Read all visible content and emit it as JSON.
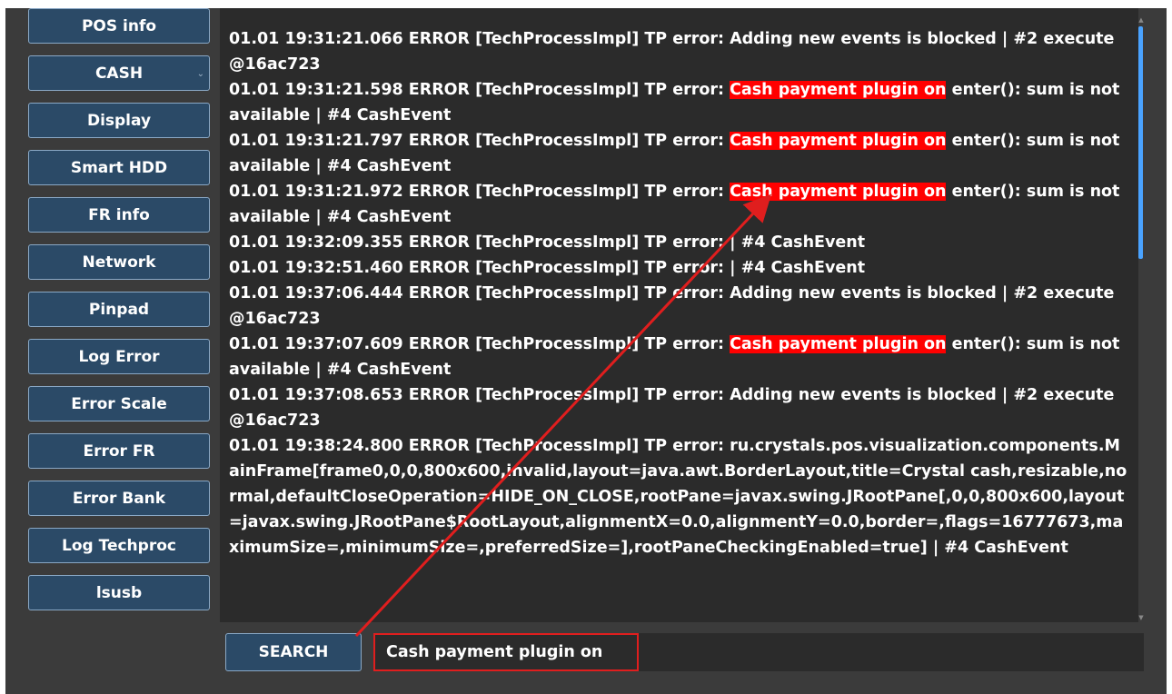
{
  "sidebar": {
    "items": [
      {
        "label": "POS info"
      },
      {
        "label": "CASH"
      },
      {
        "label": "Display"
      },
      {
        "label": "Smart HDD"
      },
      {
        "label": "FR info"
      },
      {
        "label": "Network"
      },
      {
        "label": "Pinpad"
      },
      {
        "label": "Log Error"
      },
      {
        "label": "Error Scale"
      },
      {
        "label": "Error FR"
      },
      {
        "label": "Error Bank"
      },
      {
        "label": "Log Techproc"
      },
      {
        "label": "lsusb"
      }
    ],
    "cash_chevron": "⌄"
  },
  "log": {
    "lines": [
      {
        "pre": "01.01 19:31:21.066 ERROR [TechProcessImpl] TP error: Adding new events is blocked | #2 execute@16ac723",
        "hl": "",
        "post": ""
      },
      {
        "pre": "01.01 19:31:21.598 ERROR [TechProcessImpl] TP error: ",
        "hl": "Cash payment plugin on",
        "post": " enter(): sum is not available | #4 CashEvent"
      },
      {
        "pre": "01.01 19:31:21.797 ERROR [TechProcessImpl] TP error: ",
        "hl": "Cash payment plugin on",
        "post": " enter(): sum is not available | #4 CashEvent"
      },
      {
        "pre": "01.01 19:31:21.972 ERROR [TechProcessImpl] TP error: ",
        "hl": "Cash payment plugin on",
        "post": " enter(): sum is not available | #4 CashEvent"
      },
      {
        "pre": "01.01 19:32:09.355 ERROR [TechProcessImpl] TP error:  | #4 CashEvent",
        "hl": "",
        "post": ""
      },
      {
        "pre": "01.01 19:32:51.460 ERROR [TechProcessImpl] TP error:  | #4 CashEvent",
        "hl": "",
        "post": ""
      },
      {
        "pre": "01.01 19:37:06.444 ERROR [TechProcessImpl] TP error: Adding new events is blocked | #2 execute@16ac723",
        "hl": "",
        "post": ""
      },
      {
        "pre": "01.01 19:37:07.609 ERROR [TechProcessImpl] TP error: ",
        "hl": "Cash payment plugin on",
        "post": " enter(): sum is not available | #4 CashEvent"
      },
      {
        "pre": "01.01 19:37:08.653 ERROR [TechProcessImpl] TP error: Adding new events is blocked | #2 execute@16ac723",
        "hl": "",
        "post": ""
      },
      {
        "pre": "01.01 19:38:24.800 ERROR [TechProcessImpl] TP error: ru.crystals.pos.visualization.components.MainFrame[frame0,0,0,800x600,invalid,layout=java.awt.BorderLayout,title=Crystal cash,resizable,normal,defaultCloseOperation=HIDE_ON_CLOSE,rootPane=javax.swing.JRootPane[,0,0,800x600,layout=javax.swing.JRootPane$RootLayout,alignmentX=0.0,alignmentY=0.0,border=,flags=16777673,maximumSize=,minimumSize=,preferredSize=],rootPaneCheckingEnabled=true] | #4 CashEvent",
        "hl": "",
        "post": ""
      }
    ]
  },
  "search": {
    "button_label": "SEARCH",
    "value": "Cash payment plugin on"
  },
  "scroll": {
    "up_arrow": "▲",
    "down_arrow": "▼"
  },
  "colors": {
    "highlight": "#ff0000",
    "annotation": "#e01e1e",
    "button_bg": "#2b4a67",
    "scroll_thumb": "#4aa3ff"
  }
}
